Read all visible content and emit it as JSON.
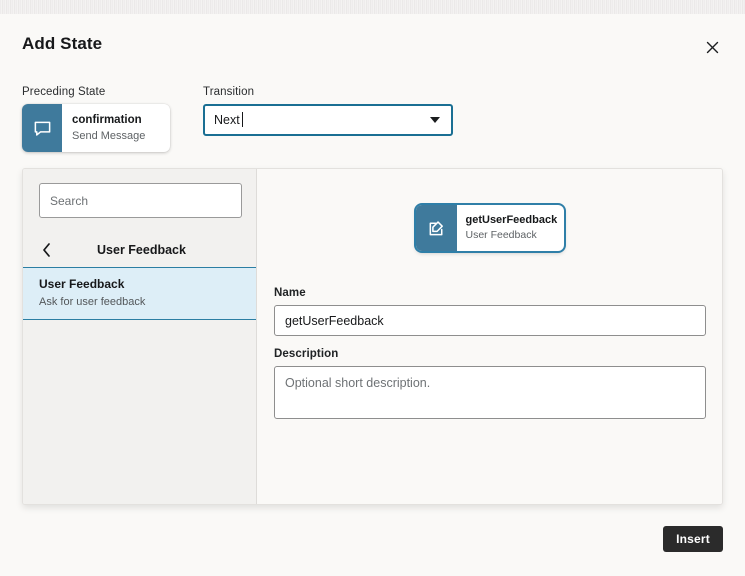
{
  "dialog": {
    "title": "Add State",
    "close_icon": "close-icon"
  },
  "preceding_state": {
    "label": "Preceding State",
    "card": {
      "title": "confirmation",
      "subtitle": "Send Message",
      "icon": "speech-bubble-icon",
      "icon_bg": "#3f7a9c"
    }
  },
  "transition": {
    "label": "Transition",
    "value": "Next",
    "arrow_icon": "chevron-down-icon",
    "focus_color": "#1a6f93"
  },
  "left_pane": {
    "search": {
      "placeholder": "Search",
      "value": ""
    },
    "nav": {
      "back_icon": "chevron-left-icon",
      "title": "User Feedback"
    },
    "items": [
      {
        "title": "User Feedback",
        "subtitle": "Ask for user feedback",
        "selected": true
      }
    ],
    "selected_bg": "#ddeef7",
    "selected_border": "#2b7ea3"
  },
  "right_pane": {
    "preview_card": {
      "title": "getUserFeedback",
      "subtitle": "User Feedback",
      "icon": "edit-square-icon",
      "icon_bg": "#3f7a9c",
      "outline_color": "#2f7fa8"
    },
    "form": {
      "name": {
        "label": "Name",
        "value": "getUserFeedback",
        "placeholder": ""
      },
      "description": {
        "label": "Description",
        "value": "",
        "placeholder": "Optional short description."
      }
    }
  },
  "footer": {
    "insert_label": "Insert",
    "insert_bg": "#2b2b2b"
  }
}
